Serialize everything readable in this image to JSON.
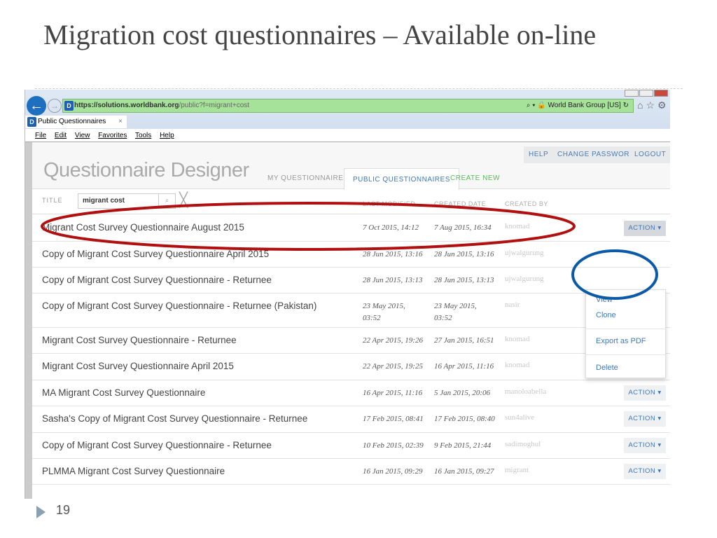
{
  "slide": {
    "title": "Migration cost questionnaires – Available on-line",
    "page_number": "19"
  },
  "browser": {
    "url_host": "https://solutions.worldbank.org",
    "url_path": "/public?f=migrant+cost",
    "site_identity": "World Bank Group [US]",
    "tab_title": "Public Questionnaires",
    "favicon_letter": "D",
    "menu": [
      "File",
      "Edit",
      "View",
      "Favorites",
      "Tools",
      "Help"
    ]
  },
  "app": {
    "logo": "Questionnaire Designer",
    "top_buttons": [
      "HELP",
      "CHANGE PASSWORD",
      "LOGOUT"
    ],
    "nav": {
      "my": "MY QUESTIONNAIRES",
      "public": "PUBLIC QUESTIONNAIRES",
      "create": "CREATE NEW"
    },
    "filter": {
      "label": "TITLE",
      "value": "migrant cost"
    },
    "columns": {
      "modified": "LAST MODIFIED",
      "created": "CREATED DATE",
      "by": "CREATED BY"
    },
    "action_label": "ACTION ▾",
    "rows": [
      {
        "title": "Migrant Cost Survey Questionnaire August 2015",
        "modified": "7 Oct 2015, 14:12",
        "created": "7 Aug 2015, 16:34",
        "by": "knomad"
      },
      {
        "title": "Copy of Migrant Cost Survey Questionnaire April 2015",
        "modified": "28 Jun 2015, 13:16",
        "created": "28 Jun 2015, 13:16",
        "by": "ujwalgurung"
      },
      {
        "title": "Copy of Migrant Cost Survey Questionnaire - Returnee",
        "modified": "28 Jun 2015, 13:13",
        "created": "28 Jun 2015, 13:13",
        "by": "ujwalgurung"
      },
      {
        "title": "Copy of Migrant Cost Survey Questionnaire - Returnee (Pakistan)",
        "modified": "23 May 2015, 03:52",
        "created": "23 May 2015, 03:52",
        "by": "nasir"
      },
      {
        "title": "Migrant Cost Survey Questionnaire - Returnee",
        "modified": "22 Apr 2015, 19:26",
        "created": "27 Jan 2015, 16:51",
        "by": "knomad"
      },
      {
        "title": "Migrant Cost Survey Questionnaire April 2015",
        "modified": "22 Apr 2015, 19:25",
        "created": "16 Apr 2015, 11:16",
        "by": "knomad"
      },
      {
        "title": "MA Migrant Cost Survey Questionnaire",
        "modified": "16 Apr 2015, 11:16",
        "created": "5 Jan 2015, 20:06",
        "by": "manoloabella"
      },
      {
        "title": "Sasha's Copy of Migrant Cost Survey Questionnaire - Returnee",
        "modified": "17 Feb 2015, 08:41",
        "created": "17 Feb 2015, 08:40",
        "by": "sun4alive"
      },
      {
        "title": "Copy of Migrant Cost Survey Questionnaire - Returnee",
        "modified": "10 Feb 2015, 02:39",
        "created": "9 Feb 2015, 21:44",
        "by": "sadimoghul"
      },
      {
        "title": "PLMMA Migrant Cost Survey Questionnaire",
        "modified": "16 Jan 2015, 09:29",
        "created": "16 Jan 2015, 09:27",
        "by": "migrant"
      }
    ],
    "dropdown": [
      "View",
      "Clone",
      "Export as PDF",
      "Delete"
    ]
  },
  "annotations": {
    "red_ellipse_color": "#b01010",
    "blue_ellipse_color": "#0b5aa8"
  }
}
